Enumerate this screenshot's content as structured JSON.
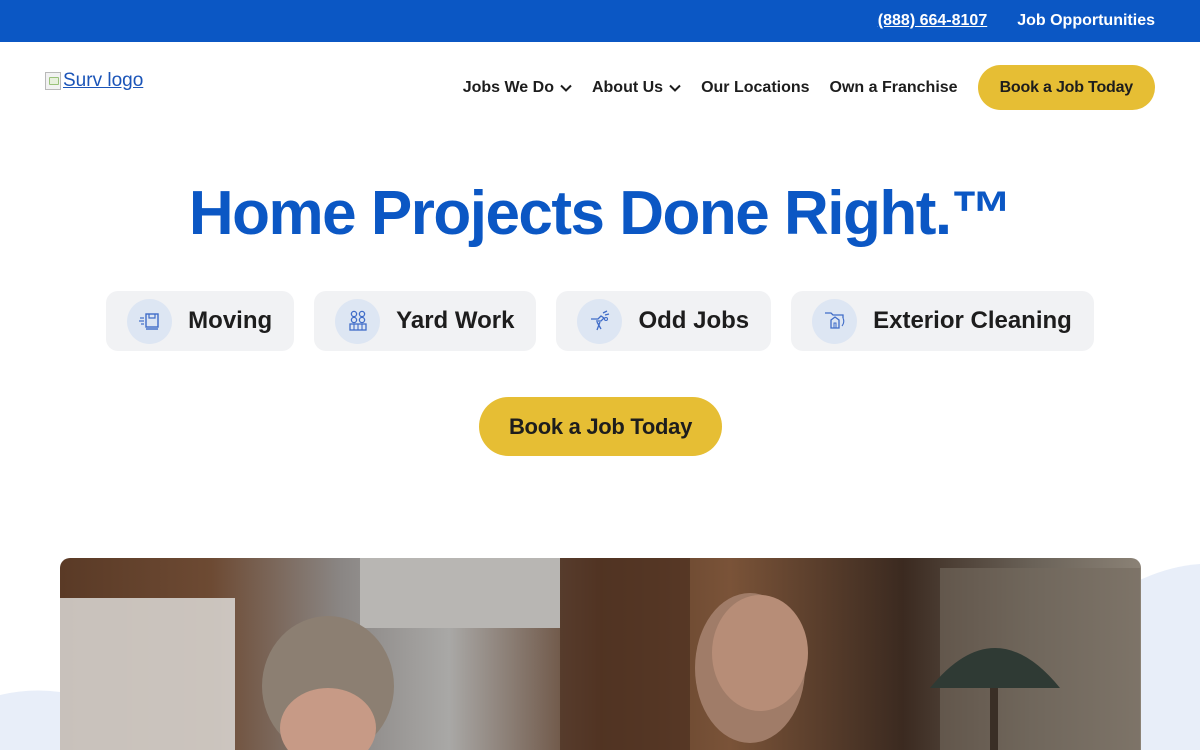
{
  "topbar": {
    "phone": "(888) 664-8107",
    "jobs_link": "Job Opportunities"
  },
  "header": {
    "logo_alt": "Surv logo",
    "nav": [
      {
        "label": "Jobs We Do",
        "has_dropdown": true
      },
      {
        "label": "About Us",
        "has_dropdown": true
      },
      {
        "label": "Our Locations",
        "has_dropdown": false
      },
      {
        "label": "Own a Franchise",
        "has_dropdown": false
      }
    ],
    "cta_label": "Book a Job Today"
  },
  "hero": {
    "title": "Home Projects Done Right.™",
    "services": [
      {
        "label": "Moving",
        "icon": "moving-box-icon"
      },
      {
        "label": "Yard Work",
        "icon": "yard-work-icon"
      },
      {
        "label": "Odd Jobs",
        "icon": "odd-jobs-icon"
      },
      {
        "label": "Exterior Cleaning",
        "icon": "exterior-cleaning-icon"
      }
    ],
    "cta_label": "Book a Job Today"
  },
  "colors": {
    "brand_blue": "#0b57c4",
    "cta_yellow": "#e6be34",
    "pill_bg": "#f1f2f4",
    "icon_circle": "#dde6f3"
  }
}
